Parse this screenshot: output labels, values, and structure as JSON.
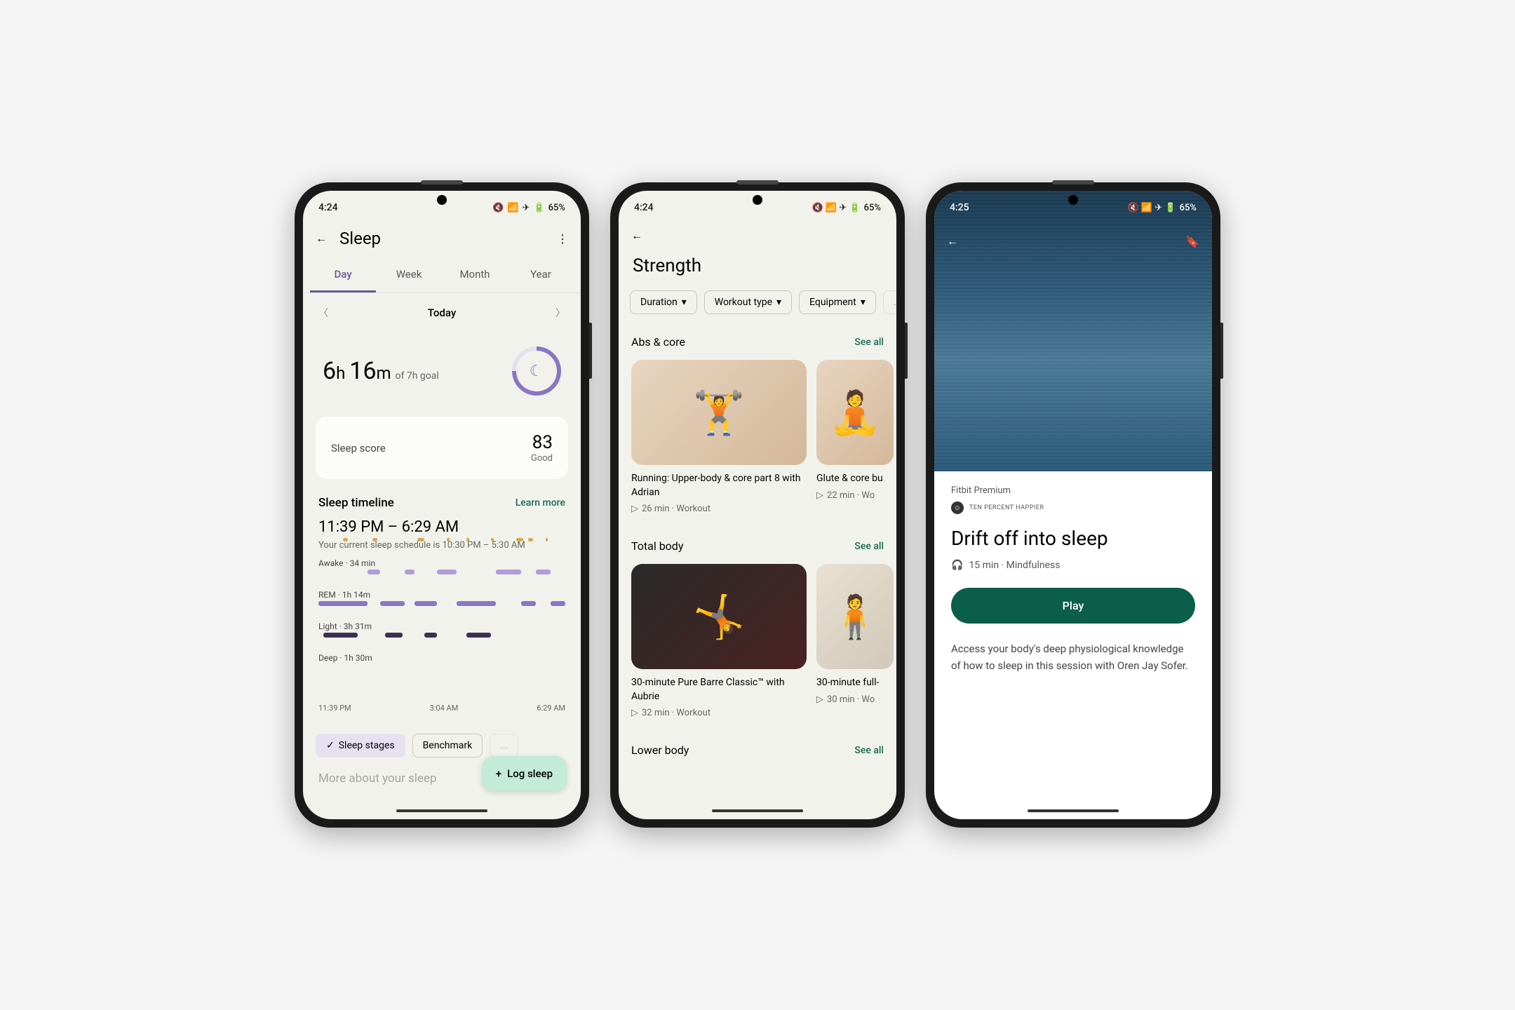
{
  "statusbar": {
    "time1": "4:24",
    "time3": "4:25",
    "battery": "65%"
  },
  "phone1": {
    "title": "Sleep",
    "tabs": [
      "Day",
      "Week",
      "Month",
      "Year"
    ],
    "activeTab": 0,
    "dateLabel": "Today",
    "summary": {
      "hours": "6",
      "mins": "16",
      "goal": "of 7h goal"
    },
    "score": {
      "label": "Sleep score",
      "value": "83",
      "rating": "Good"
    },
    "timeline": {
      "title": "Sleep timeline",
      "link": "Learn more",
      "range": "11:39 PM – 6:29 AM",
      "schedule": "Your current sleep schedule is 10:30 PM – 5:30 AM",
      "stages": {
        "awake": "Awake · 34 min",
        "rem": "REM · 1h 14m",
        "light": "Light · 3h 31m",
        "deep": "Deep · 1h 30m"
      },
      "xaxis": [
        "11:39 PM",
        "3:04 AM",
        "6:29 AM"
      ]
    },
    "chips": [
      "Sleep stages",
      "Benchmark"
    ],
    "fab": "Log sleep",
    "footerPeek": "More about your sleep"
  },
  "phone2": {
    "title": "Strength",
    "filters": [
      "Duration",
      "Workout type",
      "Equipment"
    ],
    "sections": [
      {
        "title": "Abs & core",
        "link": "See all",
        "cards": [
          {
            "title": "Running: Upper-body & core part 8 with Adrian",
            "meta": "26 min · Workout"
          },
          {
            "title": "Glute & core bu",
            "meta": "22 min · Wo"
          }
        ]
      },
      {
        "title": "Total body",
        "link": "See all",
        "cards": [
          {
            "title": "30-minute Pure Barre Classic™ with Aubrie",
            "meta": "32 min · Workout"
          },
          {
            "title": "30-minute full-",
            "meta": "30 min · Wo"
          }
        ]
      },
      {
        "title": "Lower body",
        "link": "See all",
        "cards": []
      }
    ]
  },
  "phone3": {
    "brand": "Fitbit Premium",
    "partner": "TEN PERCENT HAPPIER",
    "title": "Drift off into sleep",
    "meta": "15 min · Mindfulness",
    "play": "Play",
    "desc": "Access your body's deep physiological knowledge of how to sleep in this session with Oren Jay Sofer."
  },
  "chart_data": {
    "type": "timeline",
    "title": "Sleep timeline",
    "x_range": [
      "11:39 PM",
      "6:29 AM"
    ],
    "x_ticks": [
      "11:39 PM",
      "3:04 AM",
      "6:29 AM"
    ],
    "stages": [
      {
        "name": "Awake",
        "total": "34 min",
        "color": "#d4a84f"
      },
      {
        "name": "REM",
        "total": "1h 14m",
        "color": "#b19cdb"
      },
      {
        "name": "Light",
        "total": "3h 31m",
        "color": "#8976c4"
      },
      {
        "name": "Deep",
        "total": "1h 30m",
        "color": "#3a3155"
      }
    ]
  }
}
